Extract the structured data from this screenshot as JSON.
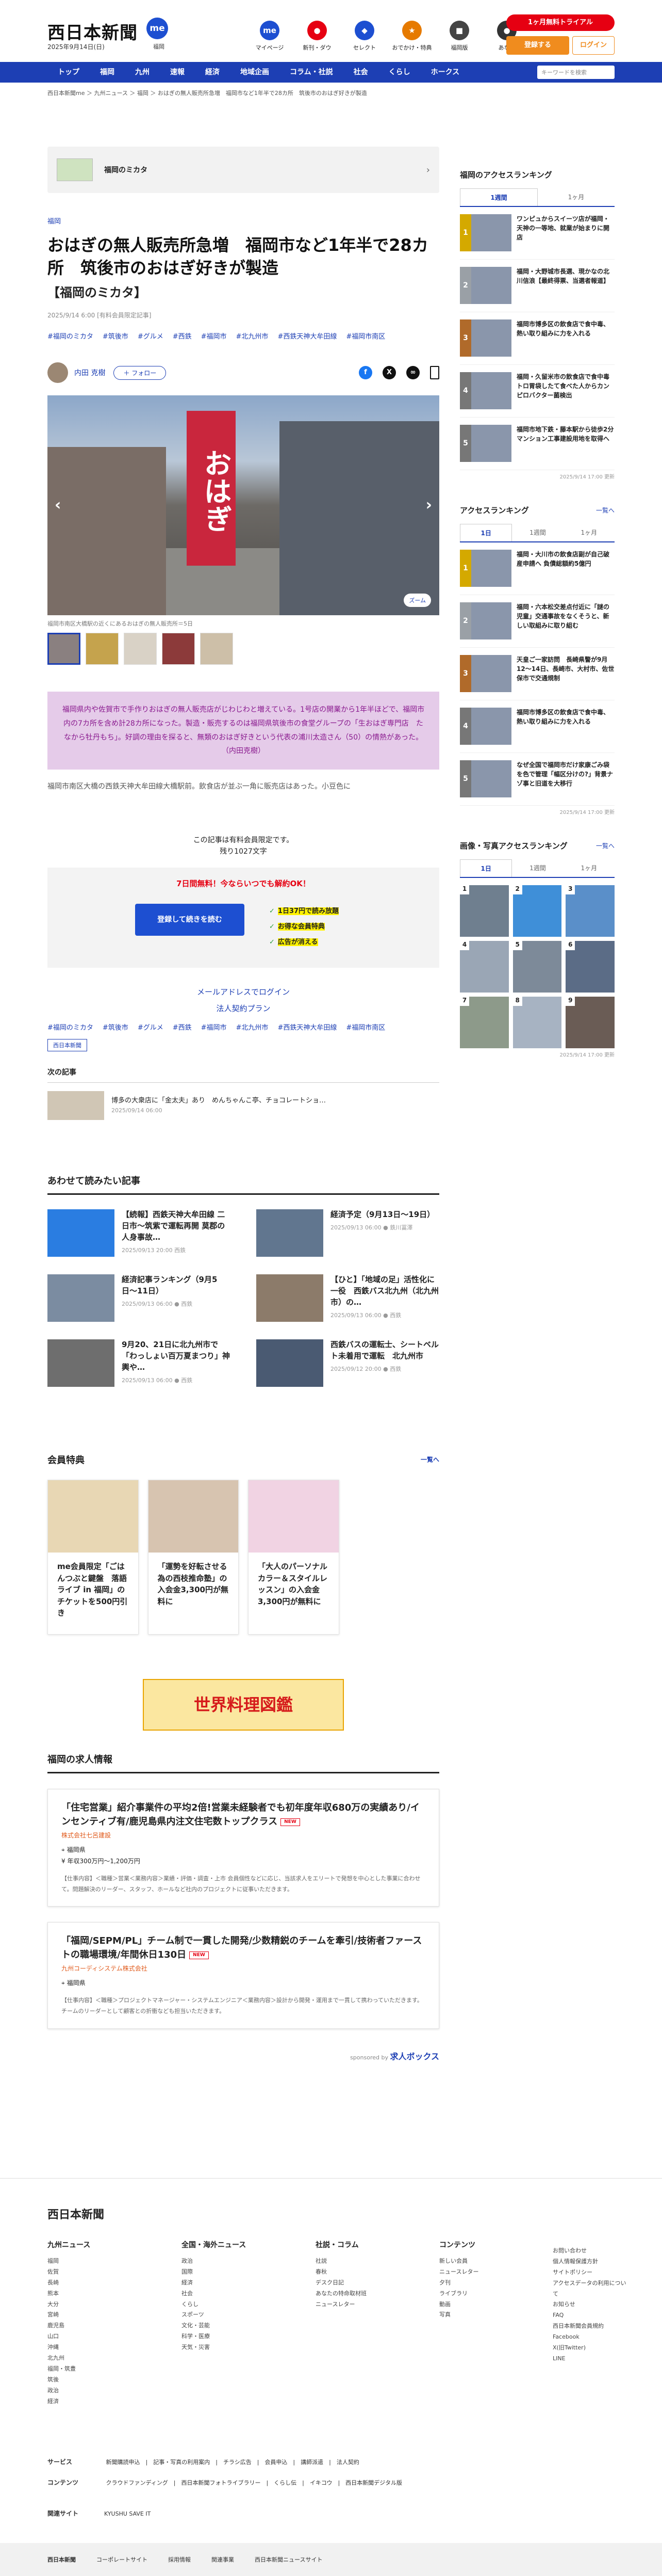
{
  "header": {
    "logo": "西日本新聞",
    "logo_badge": "me",
    "date": "2025年9月14日(日)",
    "weather": "福岡",
    "icons": [
      {
        "label": "マイページ",
        "color": "#1d4fd1",
        "glyph": "me"
      },
      {
        "label": "新刊・ダウ",
        "color": "#e60012",
        "glyph": "●"
      },
      {
        "label": "セレクト",
        "color": "#1d4fd1",
        "glyph": "◆"
      },
      {
        "label": "おでかけ・特典",
        "color": "#e67a00",
        "glyph": "★"
      },
      {
        "label": "福岡版",
        "color": "#444",
        "glyph": "■"
      },
      {
        "label": "あな雅",
        "color": "#333",
        "glyph": "●"
      }
    ],
    "trial": "1ヶ月無料トライアル",
    "register": "登録する",
    "login": "ログイン"
  },
  "nav": {
    "items": [
      "トップ",
      "福岡",
      "九州",
      "速報",
      "経済",
      "地域企画",
      "コラム・社説",
      "社会",
      "くらし",
      "ホークス"
    ],
    "search_placeholder": "キーワードを検索"
  },
  "breadcrumb": "西日本新聞me ＞ 九州ニュース ＞ 福岡 ＞ おはぎの無人販売所急増　福岡市など1年半で28カ所　筑後市のおはぎ好きが製造",
  "topbox": {
    "title": "福岡のミカタ"
  },
  "article": {
    "category": "福岡",
    "title": "おはぎの無人販売所急増　福岡市など1年半で28カ所　筑後市のおはぎ好きが製造",
    "subtitle": "【福岡のミカタ】",
    "date": "2025/9/14 6:00 [有料会員限定記事]",
    "tags": [
      "#福岡のミカタ",
      "#筑後市",
      "#グルメ",
      "#西鉄",
      "#福岡市",
      "#北九州市",
      "#西鉄天神大牟田線",
      "#福岡市南区"
    ],
    "author": "内田 克樹",
    "follow": "＋ フォロー",
    "photo_shop": "おはぎ",
    "photo_button": "ズーム",
    "photo_caption": "福岡市南区大橋駅の近くにあるおはぎの無人販売所＝5日",
    "lead": "福岡県内や佐賀市で手作りおはぎの無人販売店がじわじわと増えている。1号店の開業から1年半ほどで、福岡市内の7カ所を含め計28カ所になった。製造・販売するのは福岡県筑後市の食堂グループの「生おはぎ専門店　たなから牡丹もち」。好調の理由を探ると、無類のおはぎ好きという代表の浦川太造さん（50）の情熱があった。（内田克樹）",
    "body": "福岡市南区大橋の西鉄天神大牟田線大橋駅前。飲食店が並ぶ一角に販売店はあった。小豆色に",
    "paynote": "この記事は有料会員限定です。\n残り1027文字",
    "pay_title": "7日間無料！今ならいつでも解約OK！",
    "pay_button": "登録して続きを読む",
    "pay_list": [
      "1日37円で読み放題",
      "お得な会員特典",
      "広告が消える"
    ],
    "alt_links": [
      "メールアドレスでログイン",
      "法人契約プラン"
    ],
    "badge": "西日本新聞",
    "next_h": "次の記事",
    "next_title": "博多の大衆店に「金太夫」あり　めんちゃんこ亭、チョコレートショ…",
    "next_date": "2025/09/14 06:00"
  },
  "related": {
    "heading": "あわせて読みたい記事",
    "items": [
      {
        "title": "【続報】西鉄天神大牟田線 二日市〜筑紫で運転再開 莫郡の人身事故…",
        "meta": "2025/09/13 20:00 西鉄",
        "color": "#2a7de1"
      },
      {
        "title": "経済予定（9月13日〜19日）",
        "meta": "2025/09/13 06:00 ● 鉄川冨澤",
        "color": "#61768f"
      },
      {
        "title": "経済記事ランキング（9月5日〜11日）",
        "meta": "2025/09/13 06:00 ● 西鉄",
        "color": "#7b8ca1"
      },
      {
        "title": "【ひと】「地域の足」活性化に一役　西鉄バス北九州（北九州市）の…",
        "meta": "2025/09/13 06:00 ● 西鉄",
        "color": "#8c7b6a"
      },
      {
        "title": "9月20、21日に北九州市で「わっしょい百万夏まつり」神輿や…",
        "meta": "2025/09/13 06:00 ● 西鉄",
        "color": "#6e6e6e"
      },
      {
        "title": "西鉄バスの運転士、シートベルト未着用で運転　北九州市",
        "meta": "2025/09/12 20:00 ● 西鉄",
        "color": "#4a5a72"
      }
    ],
    "more": "一覧へ"
  },
  "members": {
    "heading": "会員特典",
    "more": "一覧へ",
    "items": [
      "me会員限定「ごはんつぶと鍵盤　落語ライブ in 福岡」のチケットを500円引き",
      "「運勢を好転させる為の西枝推命塾」の入会金3,300円が無料に",
      "「大人のパーソナルカラー＆スタイルレッスン」の入会金3,300円が無料に"
    ]
  },
  "banner": "世界料理図鑑",
  "jobs": {
    "heading": "福岡の求人情報",
    "items": [
      {
        "title": "「住宅営業」紹介事業件の平均2倍!営業未経験者でも初年度年収680万の実績あり/インセンティブ有/鹿児島県内注文住宅数トップクラス",
        "new": "NEW",
        "company": "株式会社七呂建設",
        "loc": "福岡県",
        "salary": "年収300万円〜1,200万円",
        "desc": "【仕事内容】＜職種＞営業＜業務内容＞業績・評価・調査・上市 会員個性などに応じ、当該求人をエリートで発想を中心とした事業に合わせて。問題解決のリーダー、スタッフ、ホールなど社内のプロジェクトに従事いただきます。"
      },
      {
        "title": "「福岡/SEPM/PL」チーム制で一貫した開発/少数精鋭のチームを牽引/技術者ファーストの職場環境/年間休日130日",
        "new": "NEW",
        "company": "九州コーディシステム株式会社",
        "loc": "福岡県",
        "salary": "",
        "desc": "【仕事内容】＜職種＞プロジェクトマネージャー・システムエンジニア＜業務内容＞設計から開発・運用まで一貫して携わっていただきます。チームのリーダーとして顧客との折衝なども担当いただきます。"
      }
    ],
    "sponsor": "sponsored by",
    "sponsor_name": "求人ボックス"
  },
  "sidebar": {
    "access_fukuoka": {
      "heading": "福岡のアクセスランキング",
      "tabs": [
        "1週間",
        "1ヶ月"
      ],
      "items": [
        "ワンピュからスイーツ店が福岡・天神の一等地、就業が始まりに開店",
        "福岡・大野城市長選、現かなの北川信浪【最終得票、当選者報道】",
        "福岡市博多区の飲食店で食中毒、熱い取り組みに力を入れる",
        "福岡・久留米市の飲食店で食中毒 トロ胃袋したて食べた人からカンピロバクター菌検出",
        "福岡市地下鉄・藤本駅から徒歩2分 マンション工事建設用地を取得へ"
      ],
      "foot": "2025/9/14 17:00 更新"
    },
    "access": {
      "heading": "アクセスランキング",
      "more": "一覧へ",
      "tabs": [
        "1日",
        "1週間",
        "1ヶ月"
      ],
      "items": [
        "福岡・大川市の飲食店副が自己破産申請へ 負債総額約5億円",
        "福岡・六本松交差点付近に「謎の児童」交通事故をなくそうと、新しい取組みに取り組む",
        "天皇ご一家訪問　長崎県警が9月12〜14日、長崎市、大村市、佐世保市で交通規制",
        "福岡市博多区の飲食店で食中毒、熱い取り組みに力を入れる",
        "なぜ全国で福岡市だけ家康ごみ袋を色で管理「幅区分けの?」背景ナゾ事と旧道を大移行"
      ],
      "foot": "2025/9/14 17:00 更新"
    },
    "photo": {
      "heading": "画像・写真アクセスランキング",
      "more": "一覧へ",
      "tabs": [
        "1日",
        "1週間",
        "1ヶ月"
      ],
      "foot": "2025/9/14 17:00 更新"
    }
  },
  "footer": {
    "logo": "西日本新聞",
    "cols": [
      {
        "h": "九州ニュース",
        "items": [
          "福岡",
          "佐賀",
          "長崎",
          "熊本",
          "大分",
          "宮崎",
          "鹿児島",
          "山口",
          "沖縄",
          "北九州",
          "福岡・筑豊",
          "筑後",
          "政治",
          "経済"
        ]
      },
      {
        "h": "全国・海外ニュース",
        "items": [
          "政治",
          "国際",
          "経済",
          "社会",
          "くらし",
          "スポーツ",
          "文化・芸能",
          "科学・医療",
          "天気・災害"
        ]
      },
      {
        "h": "社説・コラム",
        "items": [
          "社説",
          "春秋",
          "デスク日記",
          "あなたの特命取材班",
          "ニュースレター"
        ]
      },
      {
        "h": "コンテンツ",
        "items": [
          "新しい会員",
          "ニュースレター",
          "夕刊",
          "ライブラリ",
          "動画",
          "写真"
        ]
      },
      {
        "h": "",
        "items": [
          "お問い合わせ",
          "個人情報保護方針",
          "サイトポリシー",
          "アクセスデータの利用について",
          "お知らせ",
          "FAQ",
          "西日本新聞会員規約",
          "Facebook",
          "X(旧Twitter)",
          "LINE"
        ]
      }
    ],
    "service": [
      "新聞購読申込",
      "記事・写真の利用案内",
      "チラシ広告",
      "会員申込",
      "講師派遣",
      "法人契約"
    ],
    "content": [
      "クラウドファンディング",
      "西日本新聞フォトライブラリー",
      "くらし伝",
      "イキコウ",
      "西日本新聞デジタル版"
    ],
    "affil": "KYUSHU SAVE IT",
    "bottom": [
      "西日本新聞",
      "コーポレートサイト",
      "採用情報",
      "関連事業",
      "西日本新聞ニュースサイト"
    ]
  }
}
